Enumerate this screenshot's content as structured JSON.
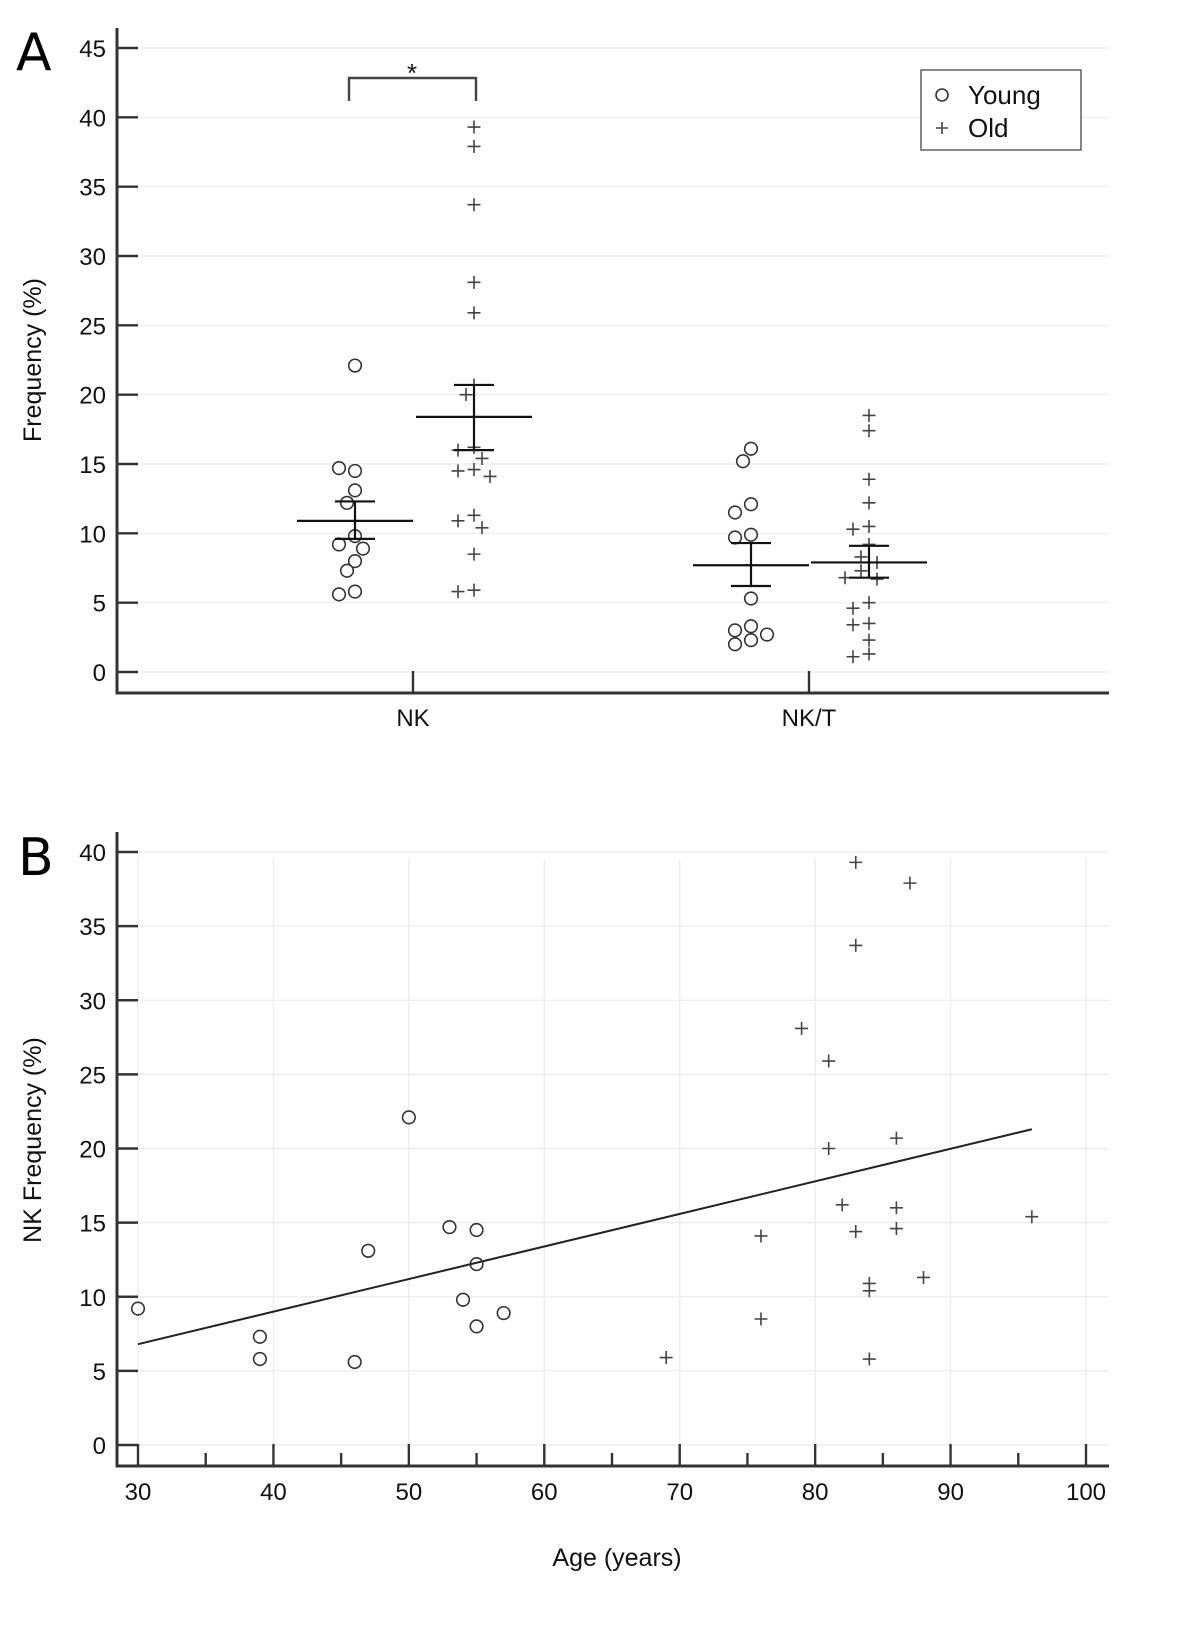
{
  "chart_data": [
    {
      "panel_label": "A",
      "type": "scatter",
      "subtype": "dot-plot-with-mean-sem",
      "title": "",
      "xlabel": "",
      "ylabel": "Frequency (%)",
      "categories": [
        "NK",
        "NK/T"
      ],
      "ylim": [
        0,
        45
      ],
      "yticks": [
        0,
        5,
        10,
        15,
        20,
        25,
        30,
        35,
        40,
        45
      ],
      "grid": true,
      "legend": {
        "placement": "top-right",
        "entries": [
          {
            "label": "Young",
            "marker": "circle"
          },
          {
            "label": "Old",
            "marker": "plus"
          }
        ]
      },
      "significance": {
        "between": [
          "NK Young",
          "NK Old"
        ],
        "label": "*"
      },
      "series": [
        {
          "name": "Young",
          "marker": "circle",
          "category": "NK",
          "values": [
            22.1,
            14.5,
            14.7,
            13.1,
            12.2,
            9.8,
            9.2,
            8.9,
            8.0,
            7.3,
            5.8,
            5.6
          ],
          "mean": 10.9,
          "sem_low": 9.6,
          "sem_high": 12.3
        },
        {
          "name": "Old",
          "marker": "plus",
          "category": "NK",
          "values": [
            39.3,
            37.9,
            33.7,
            28.1,
            25.9,
            20.7,
            20.0,
            16.2,
            16.0,
            15.4,
            14.6,
            14.5,
            14.1,
            11.3,
            10.9,
            10.4,
            8.5,
            5.9,
            5.8
          ],
          "mean": 18.4,
          "sem_low": 16.0,
          "sem_high": 20.7
        },
        {
          "name": "Young",
          "marker": "circle",
          "category": "NK/T",
          "values": [
            16.1,
            15.2,
            12.1,
            11.5,
            9.9,
            9.7,
            5.3,
            3.3,
            3.0,
            2.7,
            2.3,
            2.0
          ],
          "mean": 7.7,
          "sem_low": 6.2,
          "sem_high": 9.3
        },
        {
          "name": "Old",
          "marker": "plus",
          "category": "NK/T",
          "values": [
            18.5,
            17.4,
            13.9,
            12.2,
            10.5,
            10.3,
            9.2,
            8.3,
            7.9,
            7.3,
            6.7,
            6.8,
            5.0,
            4.6,
            3.5,
            3.4,
            2.3,
            1.3,
            1.1
          ],
          "mean": 7.9,
          "sem_low": 6.8,
          "sem_high": 9.1
        }
      ]
    },
    {
      "panel_label": "B",
      "type": "scatter",
      "title": "",
      "xlabel": "Age (years)",
      "ylabel": "NK Frequency (%)",
      "xlim": [
        30,
        100
      ],
      "ylim": [
        0,
        40
      ],
      "xticks": [
        30,
        40,
        50,
        60,
        70,
        80,
        90,
        100
      ],
      "yticks": [
        0,
        5,
        10,
        15,
        20,
        25,
        30,
        35,
        40
      ],
      "grid": true,
      "series": [
        {
          "name": "Young",
          "marker": "circle",
          "points": [
            [
              30,
              9.2
            ],
            [
              39,
              7.3
            ],
            [
              39,
              5.8
            ],
            [
              46,
              5.6
            ],
            [
              47,
              13.1
            ],
            [
              50,
              22.1
            ],
            [
              53,
              14.7
            ],
            [
              54,
              9.8
            ],
            [
              55,
              14.5
            ],
            [
              55,
              12.2
            ],
            [
              55,
              8.0
            ],
            [
              57,
              8.9
            ]
          ]
        },
        {
          "name": "Old",
          "marker": "plus",
          "points": [
            [
              69,
              5.9
            ],
            [
              76,
              14.1
            ],
            [
              76,
              8.5
            ],
            [
              79,
              28.1
            ],
            [
              81,
              25.9
            ],
            [
              81,
              20.0
            ],
            [
              82,
              16.2
            ],
            [
              83,
              39.3
            ],
            [
              83,
              33.7
            ],
            [
              83,
              14.4
            ],
            [
              84,
              10.9
            ],
            [
              84,
              10.4
            ],
            [
              84,
              5.8
            ],
            [
              86,
              20.7
            ],
            [
              86,
              16.0
            ],
            [
              86,
              14.6
            ],
            [
              87,
              37.9
            ],
            [
              88,
              11.3
            ],
            [
              96,
              15.4
            ]
          ]
        }
      ],
      "fit_line": {
        "type": "linear",
        "points": [
          [
            30,
            6.8
          ],
          [
            96,
            21.3
          ]
        ]
      }
    }
  ]
}
